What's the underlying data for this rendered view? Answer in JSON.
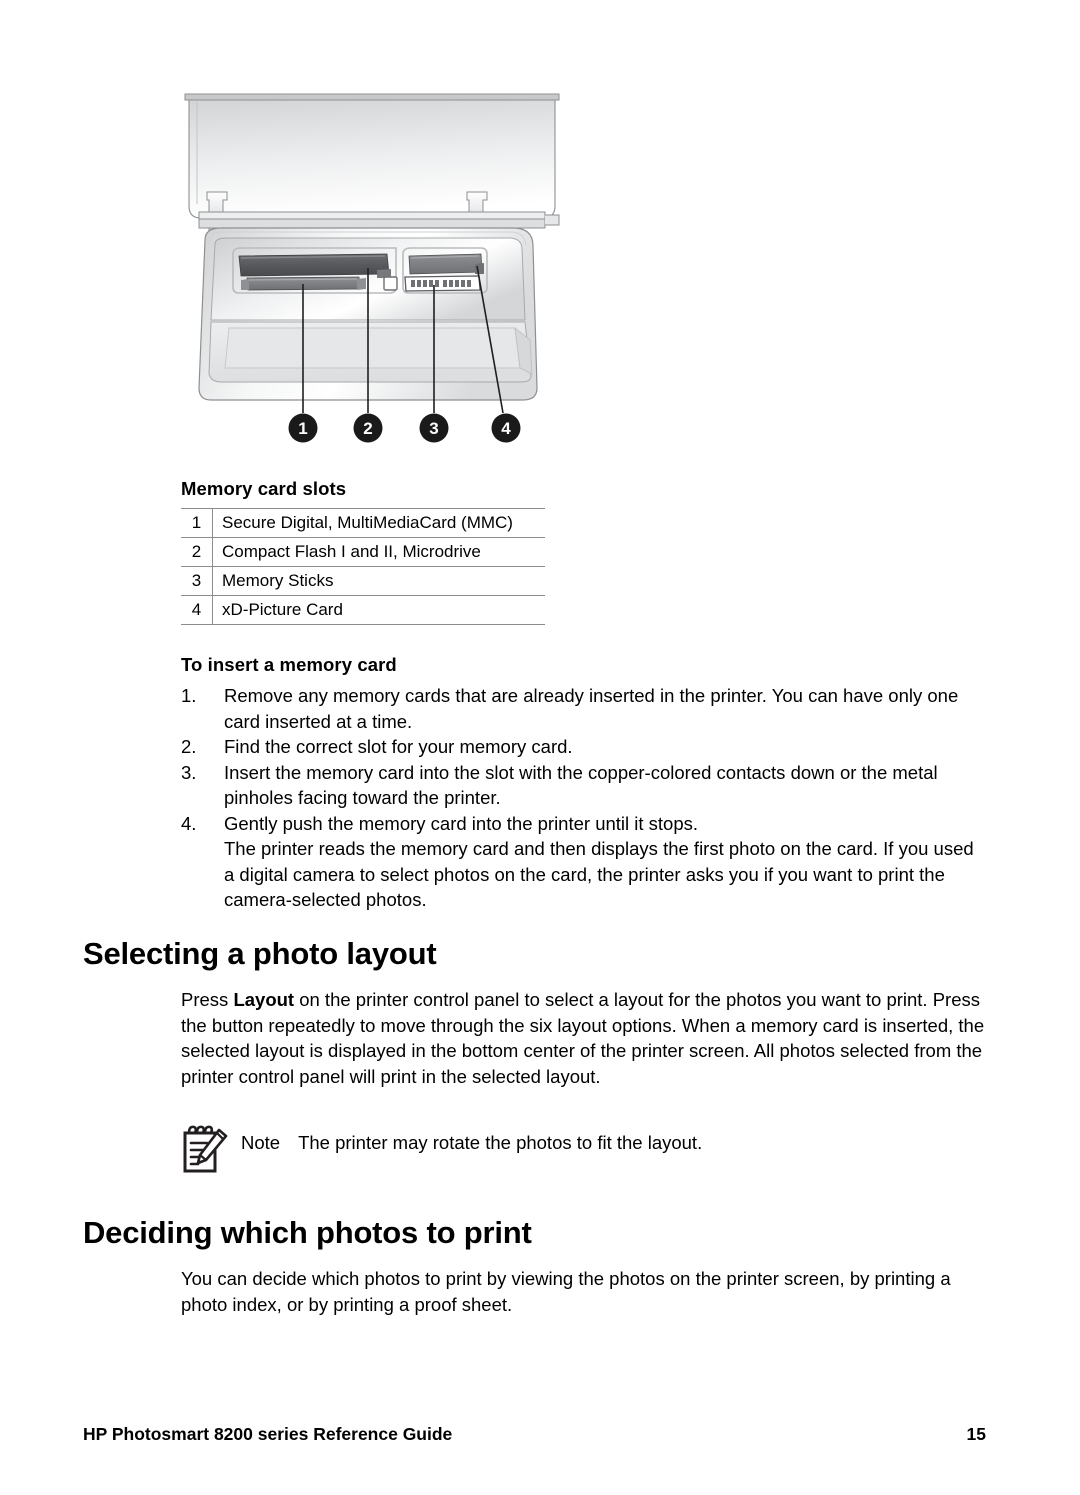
{
  "figure": {
    "alt_name": "printer-memory-card-slots-illustration",
    "callouts": [
      "1",
      "2",
      "3",
      "4"
    ]
  },
  "table": {
    "caption": "Memory card slots",
    "rows": [
      {
        "num": "1",
        "label": "Secure Digital, MultiMediaCard (MMC)"
      },
      {
        "num": "2",
        "label": "Compact Flash I and II, Microdrive"
      },
      {
        "num": "3",
        "label": "Memory Sticks"
      },
      {
        "num": "4",
        "label": "xD-Picture Card"
      }
    ]
  },
  "insert_section": {
    "heading": "To insert a memory card",
    "steps": [
      {
        "num": "1.",
        "text": "Remove any memory cards that are already inserted in the printer. You can have only one card inserted at a time."
      },
      {
        "num": "2.",
        "text": "Find the correct slot for your memory card."
      },
      {
        "num": "3.",
        "text": "Insert the memory card into the slot with the copper-colored contacts down or the metal pinholes facing toward the printer."
      },
      {
        "num": "4.",
        "text": "Gently push the memory card into the printer until it stops.",
        "extra": "The printer reads the memory card and then displays the first photo on the card. If you used a digital camera to select photos on the card, the printer asks you if you want to print the camera-selected photos."
      }
    ]
  },
  "layout_section": {
    "heading": "Selecting a photo layout",
    "para_before_bold": "Press ",
    "para_bold": "Layout",
    "para_after_bold": " on the printer control panel to select a layout for the photos you want to print. Press the button repeatedly to move through the six layout options. When a memory card is inserted, the selected layout is displayed in the bottom center of the printer screen. All photos selected from the printer control panel will print in the selected layout."
  },
  "note": {
    "label": "Note",
    "text": "The printer may rotate the photos to fit the layout."
  },
  "deciding_section": {
    "heading": "Deciding which photos to print",
    "para": "You can decide which photos to print by viewing the photos on the printer screen, by printing a photo index, or by printing a proof sheet."
  },
  "footer": {
    "title": "HP Photosmart 8200 series Reference Guide",
    "page_number": "15"
  },
  "colors": {
    "text": "#000000",
    "rule": "#8c8c8c",
    "callout_fill": "#1a1a1a",
    "device_light": "#f2f2f2",
    "device_mid": "#d9d9d9",
    "slot_dark": "#565656"
  }
}
